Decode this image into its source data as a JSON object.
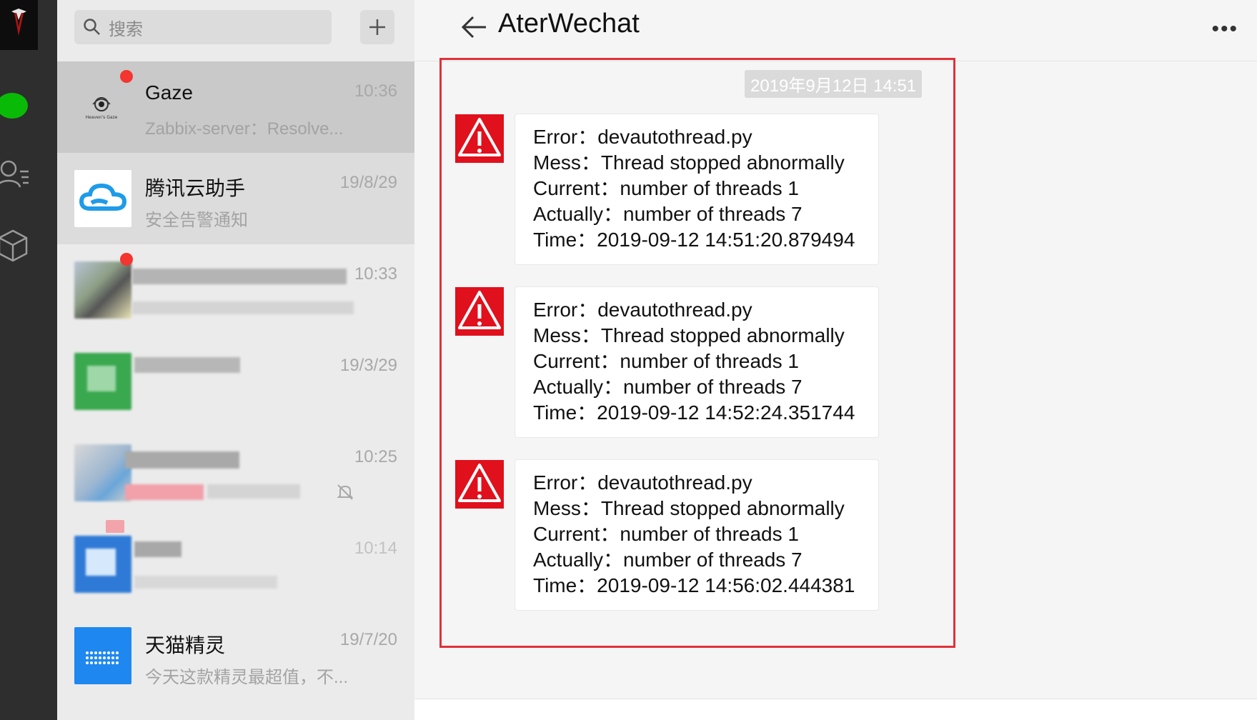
{
  "search": {
    "placeholder": "搜索"
  },
  "chat": {
    "title": "AterWechat",
    "timestamp": "2019年9月12日 14:51",
    "messages": [
      {
        "error": "Error：devautothread.py",
        "mess": "Mess：Thread stopped abnormally",
        "current": "Current：number of threads 1",
        "actually": "Actually：number of threads 7",
        "time": "Time：2019-09-12 14:51:20.879494"
      },
      {
        "error": "Error：devautothread.py",
        "mess": "Mess：Thread stopped abnormally",
        "current": "Current：number of threads 1",
        "actually": "Actually：number of threads 7",
        "time": "Time：2019-09-12 14:52:24.351744"
      },
      {
        "error": "Error：devautothread.py",
        "mess": "Mess：Thread stopped abnormally",
        "current": "Current：number of threads 1",
        "actually": "Actually：number of threads 7",
        "time": "Time：2019-09-12 14:56:02.444381"
      }
    ]
  },
  "sessions": [
    {
      "name": "Gaze",
      "time": "10:36",
      "preview": "Zabbix-server：Resolve...",
      "avatar_text": "Heaven's Gaze"
    },
    {
      "name": "腾讯云助手",
      "time": "19/8/29",
      "preview": "安全告警通知"
    },
    {
      "name": "",
      "time": "10:33",
      "preview": ""
    },
    {
      "name": "",
      "time": "19/3/29",
      "preview": ""
    },
    {
      "name": "",
      "time": "10:25",
      "preview": ""
    },
    {
      "name": "",
      "time": "10:14",
      "preview": ""
    },
    {
      "name": "天猫精灵",
      "time": "19/7/20",
      "preview": "今天这款精灵最超值，不..."
    }
  ],
  "colors": {
    "accent_red": "#e0313a",
    "wechat_green": "#09bb07",
    "unread_dot": "#f43530"
  }
}
